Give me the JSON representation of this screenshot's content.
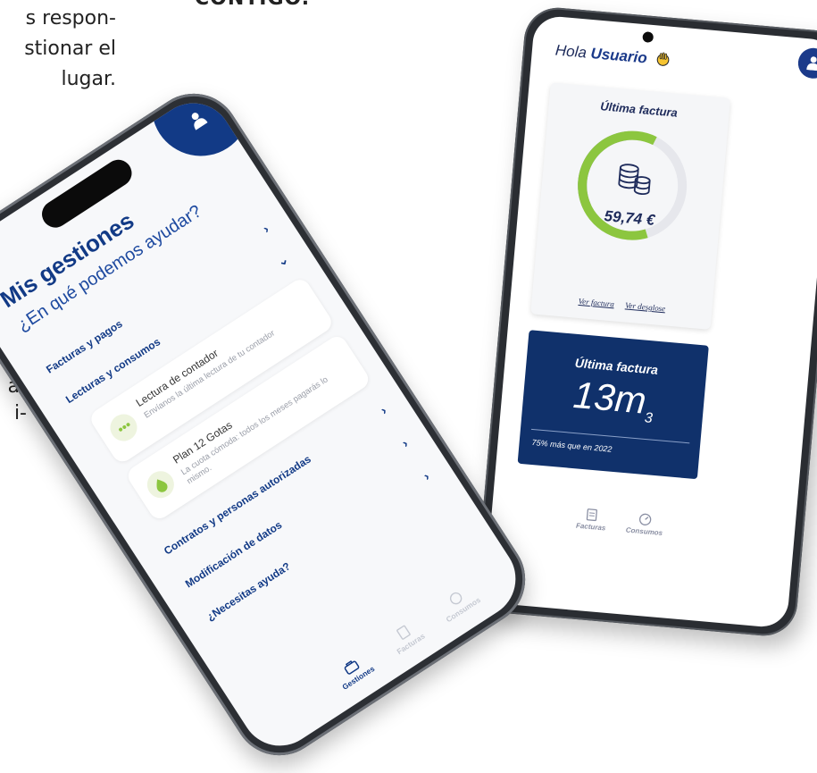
{
  "background": {
    "paragraph_lines": [
      "s respon-",
      "stionar el",
      "lugar."
    ],
    "heading": "CONTIGO.",
    "fragment_lines": [
      "-",
      "a-",
      "i-"
    ]
  },
  "right_phone": {
    "greeting_prefix": "Hola",
    "greeting_name": "Usuario",
    "last_invoice_card": {
      "title": "Última factura",
      "amount": "59,74 €",
      "ring_fraction_green": 0.62,
      "link_view": "Ver factura",
      "link_breakdown": "Ver desglose"
    },
    "consumption_card": {
      "title": "Última factura",
      "value": "13m",
      "unit_suffix": "3",
      "note": "75% más que en 2022"
    },
    "bottom_nav": [
      "Facturas",
      "Consumos"
    ]
  },
  "left_phone": {
    "title": "Mis gestiones",
    "question": "¿En qué podemos ayudar?",
    "menu": {
      "facturas": "Facturas y pagos",
      "lecturas": "Lecturas y consumos",
      "contratos": "Contratos y personas autorizadas",
      "modificacion": "Modificación de datos",
      "ayuda": "¿Necesitas ayuda?"
    },
    "sub_items": [
      {
        "title": "Lectura de contador",
        "desc": "Envíanos la última lectura de tu contador"
      },
      {
        "title": "Plan 12 Gotas",
        "desc": "La cuota cómoda: todos los meses pagarás lo mismo."
      }
    ],
    "tabs": {
      "gestiones": "Gestiones",
      "facturas": "Facturas",
      "consumos": "Consumos"
    }
  },
  "colors": {
    "brand_blue": "#123a86",
    "dark_navy": "#10316b",
    "accent_green": "#8cc63f",
    "ring_gray": "#8b8fa6"
  }
}
